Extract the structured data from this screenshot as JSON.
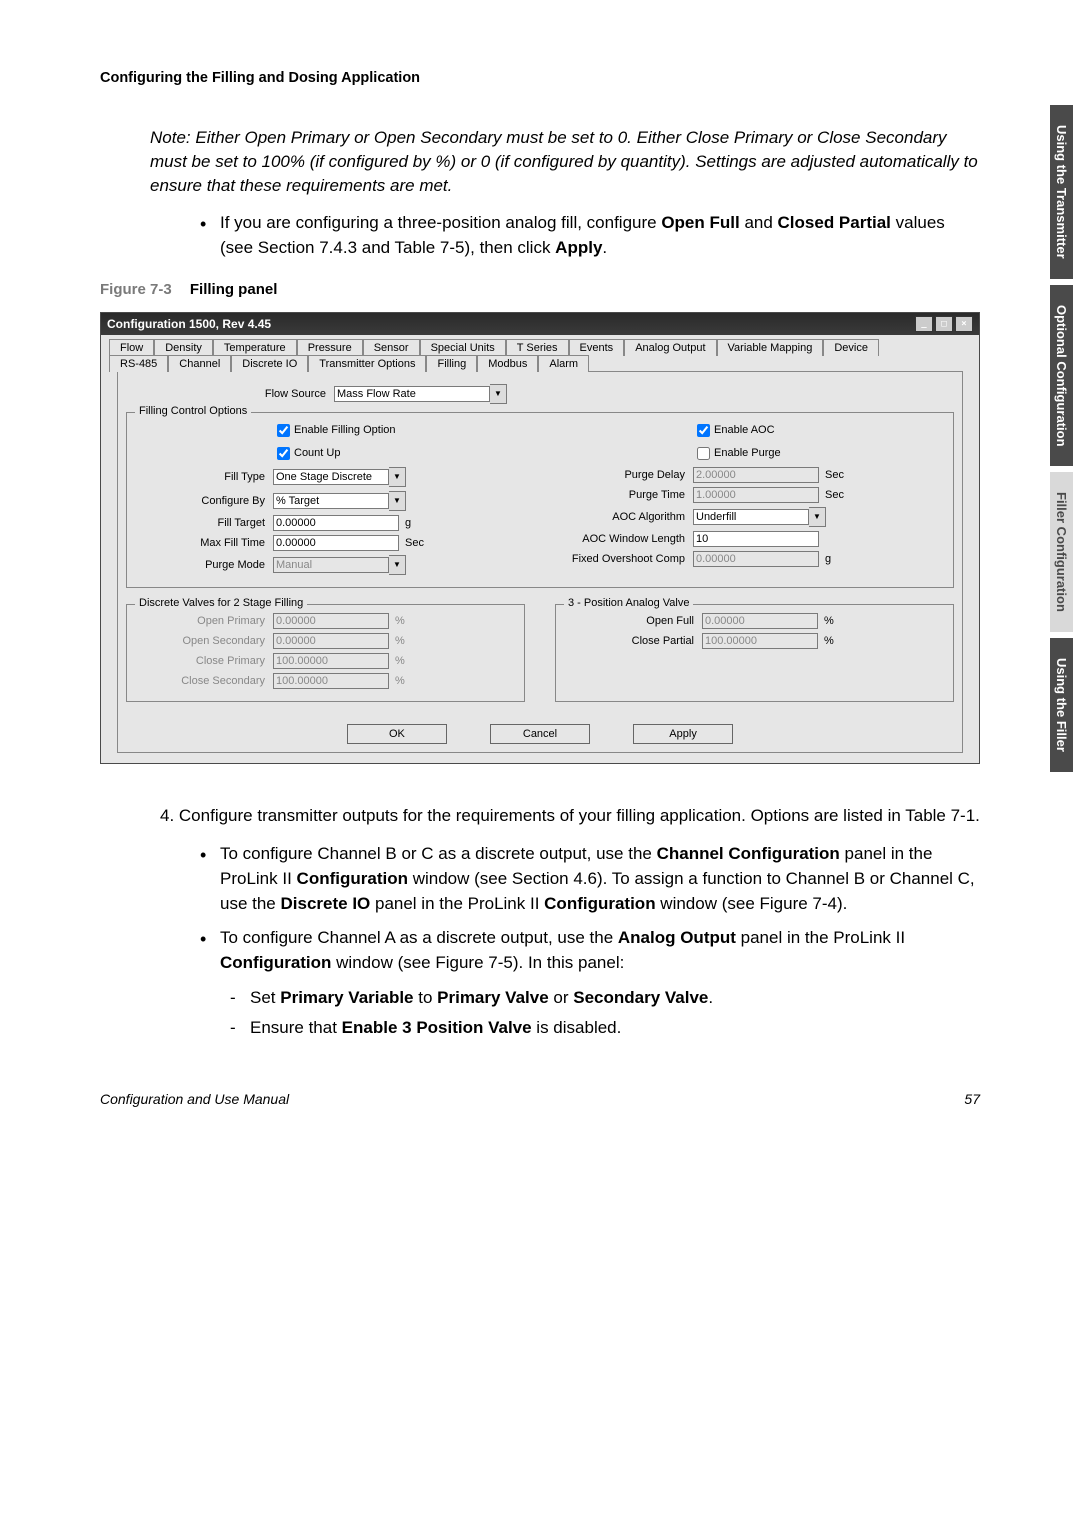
{
  "section_title": "Configuring the Filling and Dosing Application",
  "note": "Note: Either Open Primary or Open Secondary must be set to 0. Either Close Primary or Close Secondary must be set to 100% (if configured by %) or 0 (if configured by quantity). Settings are adjusted automatically to ensure that these requirements are met.",
  "bullet1_pre": "If you are configuring a three-position analog fill, configure ",
  "bullet1_b1": "Open Full",
  "bullet1_mid": " and ",
  "bullet1_b2": "Closed Partial",
  "bullet1_post": " values (see Section 7.4.3 and Table 7-5), then click ",
  "bullet1_b3": "Apply",
  "bullet1_end": ".",
  "fig_num": "Figure 7-3",
  "fig_title": "Filling panel",
  "window_title": "Configuration 1500, Rev 4.45",
  "tabs_row1": [
    "Flow",
    "Density",
    "Temperature",
    "Pressure",
    "Sensor",
    "Special Units",
    "T Series",
    "Events",
    "Analog Output",
    "Variable Mapping",
    "Device"
  ],
  "tabs_row2": [
    "RS-485",
    "Channel",
    "Discrete IO",
    "Transmitter Options",
    "Filling",
    "Modbus",
    "Alarm"
  ],
  "flow_source_label": "Flow Source",
  "flow_source_value": "Mass Flow Rate",
  "fs_filling": "Filling Control Options",
  "chk_enable_filling": "Enable Filling Option",
  "chk_count_up": "Count Up",
  "chk_enable_aoc": "Enable AOC",
  "chk_enable_purge": "Enable Purge",
  "fill_type_label": "Fill Type",
  "fill_type_value": "One Stage Discrete",
  "configure_by_label": "Configure By",
  "configure_by_value": "% Target",
  "fill_target_label": "Fill Target",
  "fill_target_value": "0.00000",
  "fill_target_unit": "g",
  "max_fill_time_label": "Max Fill Time",
  "max_fill_time_value": "0.00000",
  "max_fill_time_unit": "Sec",
  "purge_mode_label": "Purge Mode",
  "purge_mode_value": "Manual",
  "purge_delay_label": "Purge Delay",
  "purge_delay_value": "2.00000",
  "purge_delay_unit": "Sec",
  "purge_time_label": "Purge Time",
  "purge_time_value": "1.00000",
  "purge_time_unit": "Sec",
  "aoc_alg_label": "AOC Algorithm",
  "aoc_alg_value": "Underfill",
  "aoc_win_label": "AOC Window Length",
  "aoc_win_value": "10",
  "fixed_over_label": "Fixed Overshoot Comp",
  "fixed_over_value": "0.00000",
  "fixed_over_unit": "g",
  "fs_discrete": "Discrete Valves for 2 Stage Filling",
  "open_primary_label": "Open Primary",
  "open_primary_value": "0.00000",
  "open_secondary_label": "Open Secondary",
  "open_secondary_value": "0.00000",
  "close_primary_label": "Close Primary",
  "close_primary_value": "100.00000",
  "close_secondary_label": "Close Secondary",
  "close_secondary_value": "100.00000",
  "pct": "%",
  "fs_analog": "3 - Position Analog Valve",
  "open_full_label": "Open Full",
  "open_full_value": "0.00000",
  "close_partial_label": "Close Partial",
  "close_partial_value": "100.00000",
  "btn_ok": "OK",
  "btn_cancel": "Cancel",
  "btn_apply": "Apply",
  "step4_num": "4. ",
  "step4": "Configure transmitter outputs for the requirements of your filling application. Options are listed in Table 7-1.",
  "sb1_pre": "To configure Channel B or C as a discrete output, use the ",
  "sb1_b1": "Channel Configuration",
  "sb1_mid1": " panel in the ProLink II ",
  "sb1_b2": "Configuration",
  "sb1_mid2": " window (see Section 4.6). To assign a function to Channel B or Channel C, use the ",
  "sb1_b3": "Discrete IO",
  "sb1_mid3": " panel in the ProLink II ",
  "sb1_b4": "Configuration",
  "sb1_end": " window (see Figure 7-4).",
  "sb2_pre": "To configure Channel A as a discrete output, use the ",
  "sb2_b1": "Analog Output",
  "sb2_mid": " panel in the ProLink II ",
  "sb2_b2": "Configuration",
  "sb2_end": " window (see Figure 7-5). In this panel:",
  "d1_pre": "Set ",
  "d1_b1": "Primary Variable",
  "d1_mid": " to ",
  "d1_b2": "Primary Valve",
  "d1_or": " or ",
  "d1_b3": "Secondary Valve",
  "d1_end": ".",
  "d2_pre": "Ensure that ",
  "d2_b": "Enable 3 Position Valve",
  "d2_end": " is disabled.",
  "footer_left": "Configuration and Use Manual",
  "footer_right": "57",
  "side_tabs": [
    "Using the Transmitter",
    "Optional Configuration",
    "Filler Configuration",
    "Using the Filler"
  ]
}
